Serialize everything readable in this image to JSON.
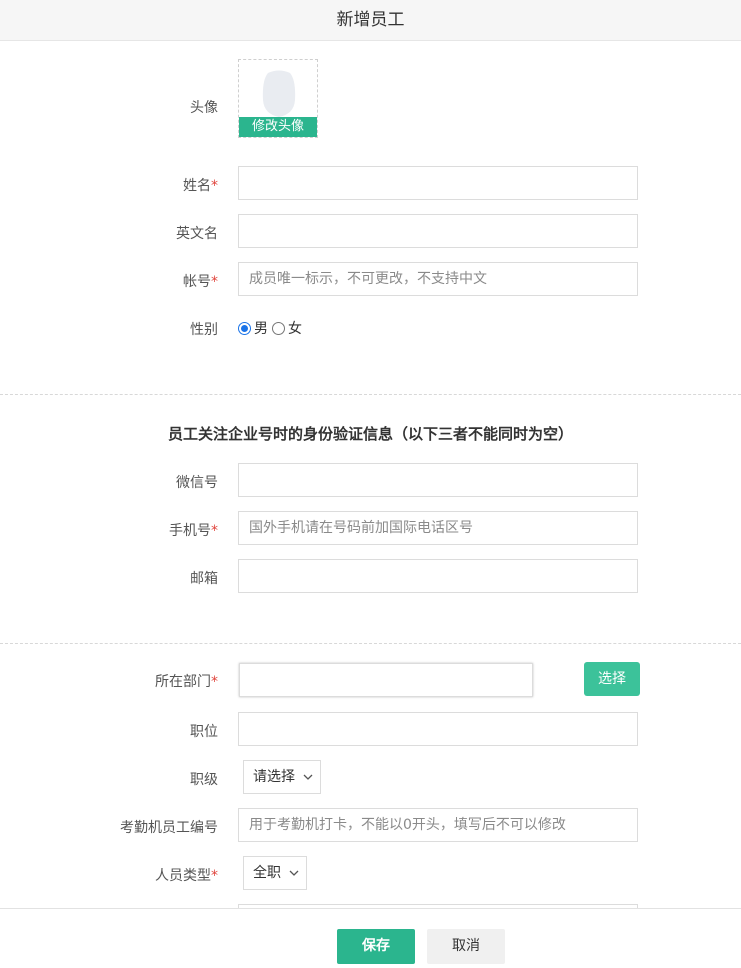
{
  "header": {
    "title": "新增员工"
  },
  "avatar": {
    "label": "头像",
    "button": "修改头像"
  },
  "fields": {
    "name": {
      "label": "姓名",
      "required": "*",
      "value": "",
      "placeholder": ""
    },
    "english_name": {
      "label": "英文名",
      "value": "",
      "placeholder": ""
    },
    "account": {
      "label": "帐号",
      "required": "*",
      "value": "",
      "placeholder": "成员唯一标示，不可更改，不支持中文"
    },
    "gender": {
      "label": "性别",
      "options": [
        "男",
        "女"
      ],
      "selected": "男"
    }
  },
  "verify_section": {
    "title": "员工关注企业号时的身份验证信息（以下三者不能同时为空）",
    "wechat": {
      "label": "微信号",
      "value": "",
      "placeholder": ""
    },
    "mobile": {
      "label": "手机号",
      "required": "*",
      "value": "",
      "placeholder": "国外手机请在号码前加国际电话区号"
    },
    "email": {
      "label": "邮箱",
      "value": "",
      "placeholder": ""
    }
  },
  "org_section": {
    "department": {
      "label": "所在部门",
      "required": "*",
      "value": "",
      "select_button": "选择"
    },
    "position": {
      "label": "职位",
      "value": ""
    },
    "level": {
      "label": "职级",
      "selected": "请选择"
    },
    "attendance_id": {
      "label": "考勤机员工编号",
      "value": "",
      "placeholder": "用于考勤机打卡，不能以0开头，填写后不可以修改"
    },
    "staff_type": {
      "label": "人员类型",
      "required": "*",
      "selected": "全职"
    }
  },
  "footer": {
    "save": "保存",
    "cancel": "取消"
  },
  "colors": {
    "accent": "#2bb58e",
    "select_button": "#3cc29a",
    "required": "#e0443c",
    "radio": "#1a73e8"
  }
}
